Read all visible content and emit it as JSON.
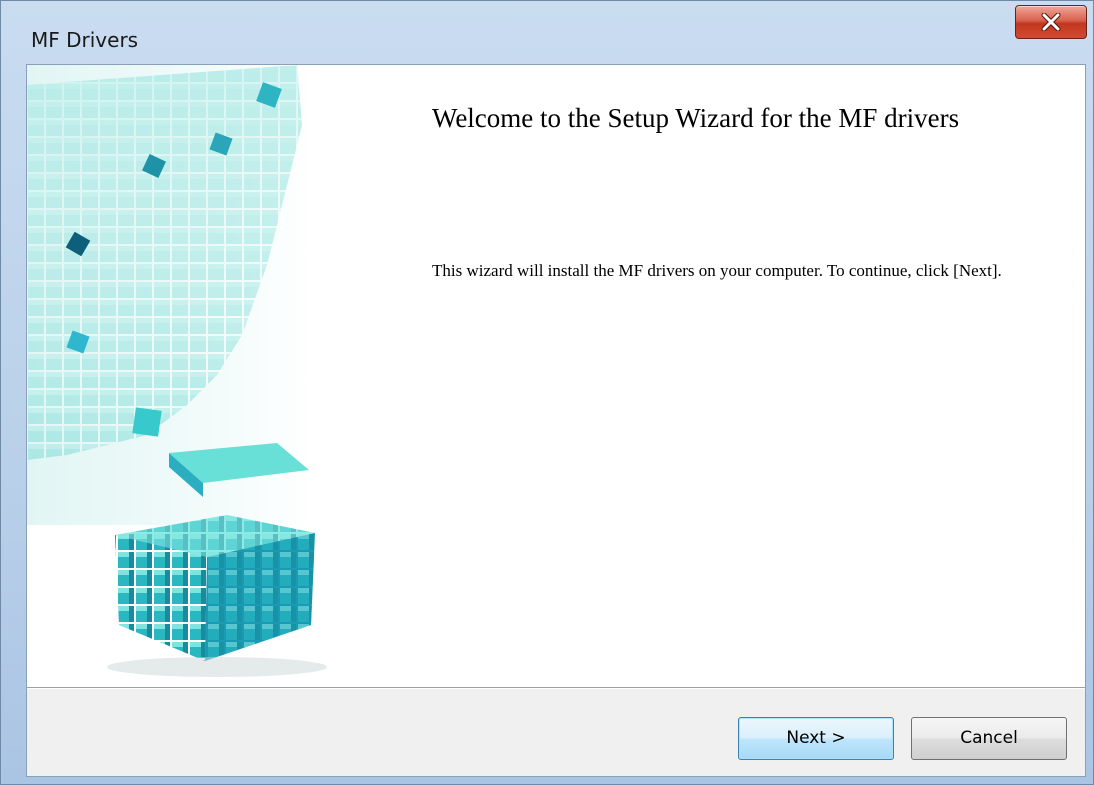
{
  "window": {
    "title": "MF Drivers"
  },
  "titlebar": {
    "close_icon": "close-x-icon",
    "close_color": "#c9402a"
  },
  "banner": {
    "image": "cubes-illustration",
    "accent_color": "#3cc6c6"
  },
  "content": {
    "heading": "Welcome to the Setup Wizard for the MF drivers",
    "description": "This wizard will install the MF drivers on your computer. To continue, click [Next]."
  },
  "buttons": {
    "next_label": "Next >",
    "cancel_label": "Cancel"
  }
}
